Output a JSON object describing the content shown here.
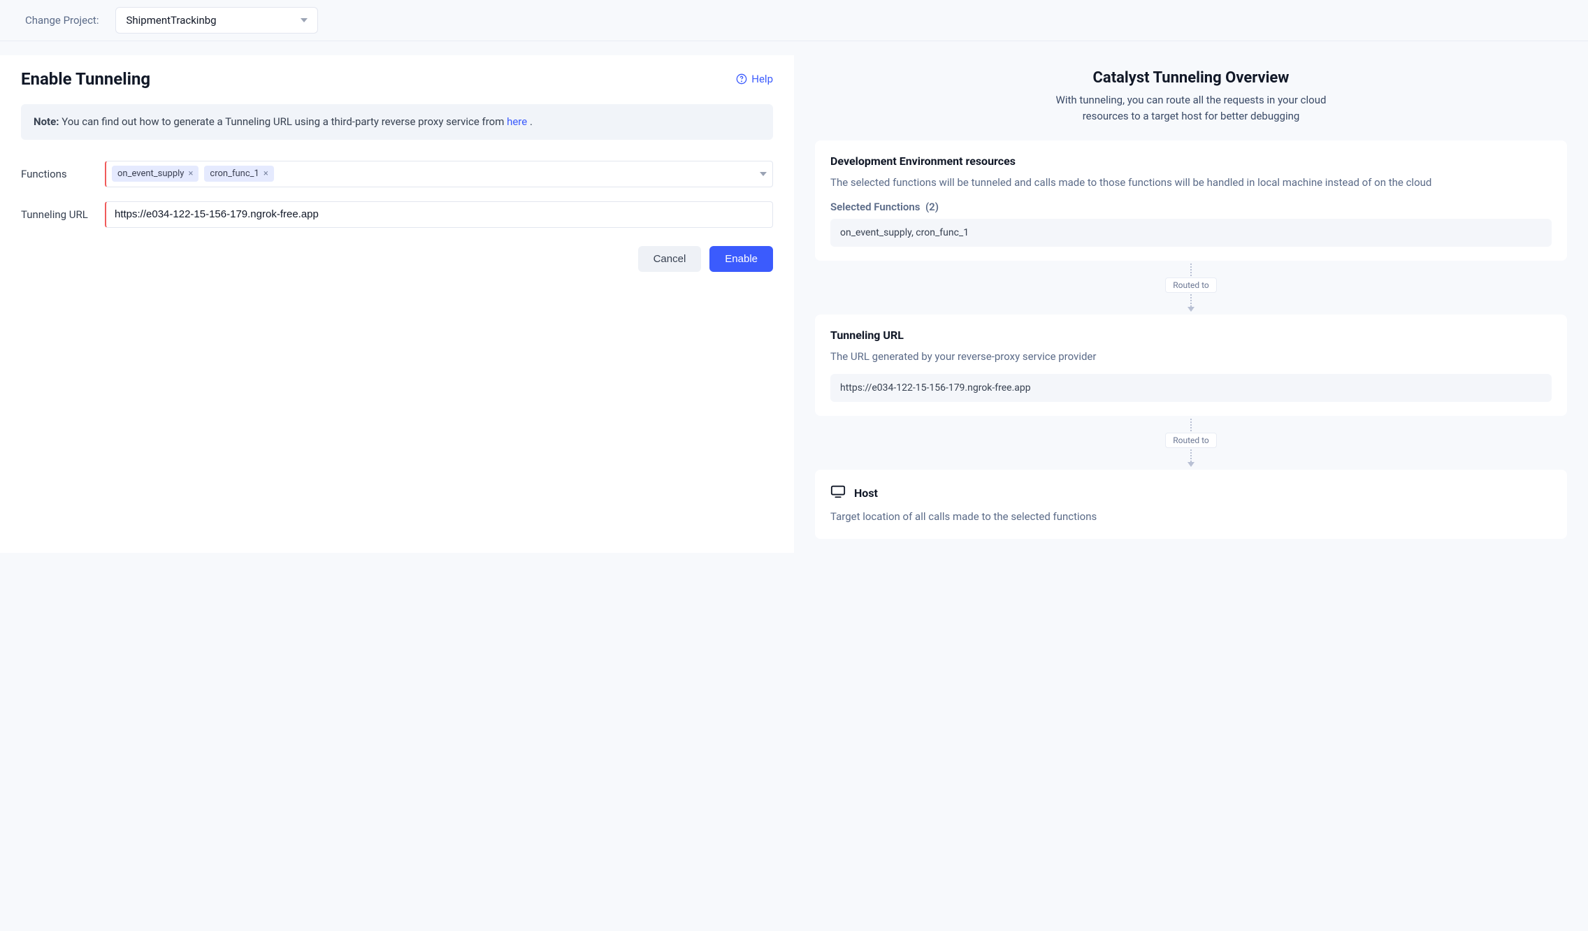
{
  "topbar": {
    "change_project_label": "Change Project:",
    "project_name": "ShipmentTrackinbg"
  },
  "left": {
    "title": "Enable Tunneling",
    "help_label": "Help",
    "note_label": "Note:",
    "note_text_1": "You can find out how to generate a Tunneling URL using a third-party reverse proxy service from ",
    "note_link": "here",
    "note_text_2": " .",
    "functions_label": "Functions",
    "function_chips": [
      "on_event_supply",
      "cron_func_1"
    ],
    "tunneling_url_label": "Tunneling URL",
    "tunneling_url_value": "https://e034-122-15-156-179.ngrok-free.app",
    "cancel_label": "Cancel",
    "enable_label": "Enable"
  },
  "right": {
    "overview_title": "Catalyst Tunneling Overview",
    "overview_sub": "With tunneling, you can route all the requests in your cloud resources to a target host for better debugging",
    "card1_title": "Development Environment resources",
    "card1_sub": "The selected functions will be tunneled and calls made to those functions will be handled in local machine instead of on the cloud",
    "selected_functions_label": "Selected Functions",
    "selected_functions_count": "(2)",
    "selected_functions_value": "on_event_supply, cron_func_1",
    "routed_label": "Routed to",
    "card2_title": "Tunneling URL",
    "card2_sub": "The URL generated by your reverse-proxy service provider",
    "card2_url": "https://e034-122-15-156-179.ngrok-free.app",
    "card3_title": "Host",
    "card3_sub": "Target location of all calls made to the selected functions"
  }
}
